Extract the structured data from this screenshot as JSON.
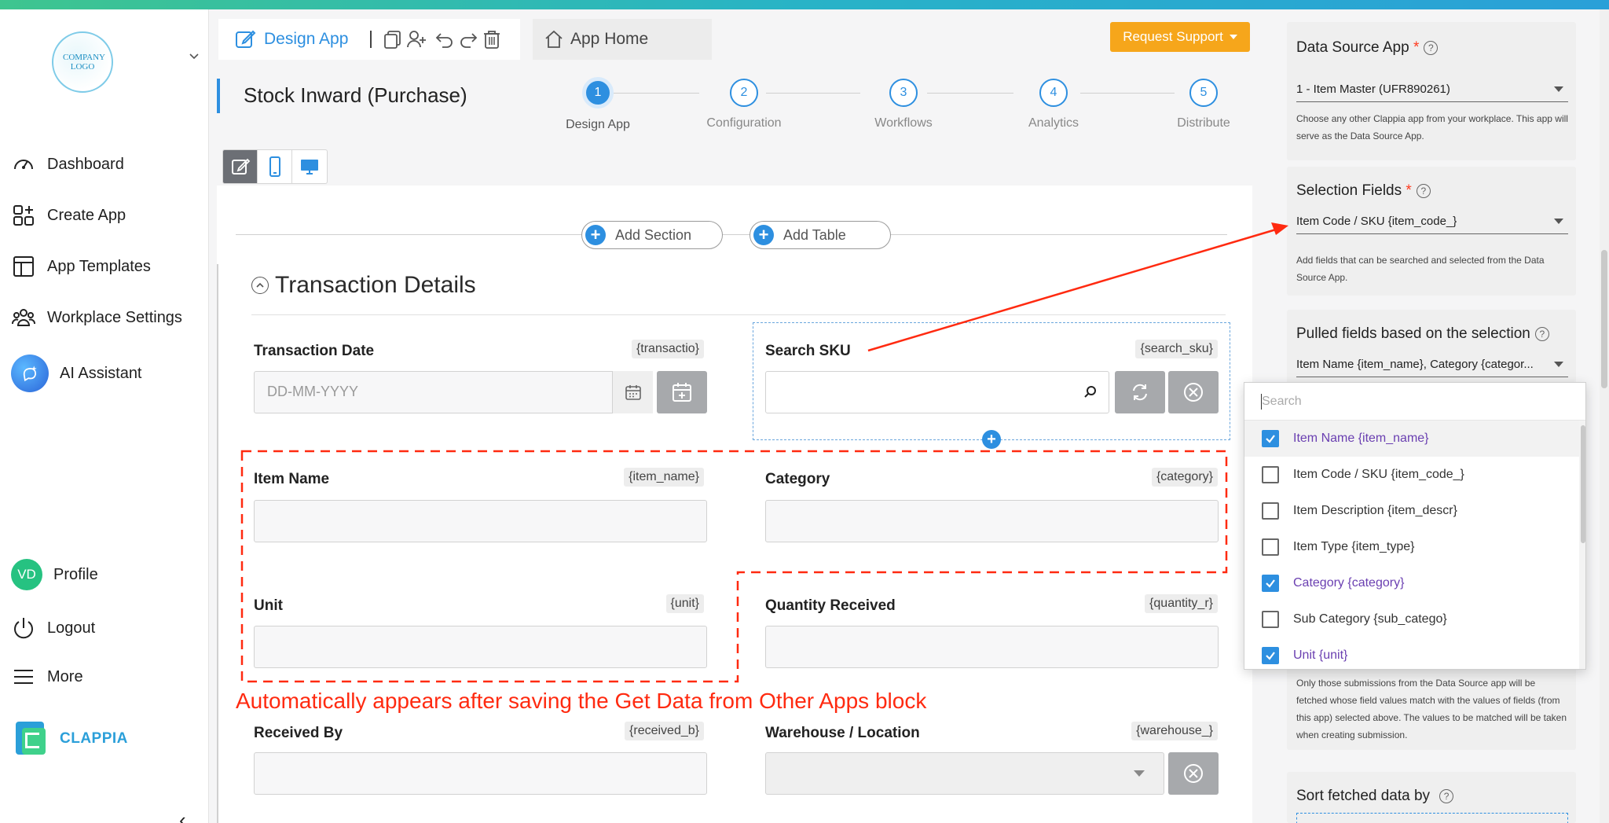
{
  "sidebar": {
    "logo_text": "COMPANY LOGO",
    "nav": [
      {
        "label": "Dashboard",
        "icon": "speedometer-icon"
      },
      {
        "label": "Create App",
        "icon": "grid-plus-icon"
      },
      {
        "label": "App Templates",
        "icon": "layout-icon"
      },
      {
        "label": "Workplace Settings",
        "icon": "users-gear-icon"
      },
      {
        "label": "AI Assistant",
        "icon": "ai-sparkle-icon"
      }
    ],
    "bottom": [
      {
        "label": "Profile",
        "avatar_initials": "VD"
      },
      {
        "label": "Logout",
        "icon": "power-icon"
      },
      {
        "label": "More",
        "icon": "hamburger-icon"
      }
    ],
    "brand": "CLAPPIA",
    "avatar_color": "#26c281"
  },
  "toolbar": {
    "design_app": "Design App",
    "app_home": "App Home",
    "request_support": "Request Support"
  },
  "app": {
    "title": "Stock Inward (Purchase)",
    "steps": [
      {
        "num": "1",
        "label": "Design App",
        "active": true
      },
      {
        "num": "2",
        "label": "Configuration",
        "active": false
      },
      {
        "num": "3",
        "label": "Workflows",
        "active": false
      },
      {
        "num": "4",
        "label": "Analytics",
        "active": false
      },
      {
        "num": "5",
        "label": "Distribute",
        "active": false
      }
    ]
  },
  "canvas": {
    "add_section": "Add Section",
    "add_table": "Add Table",
    "section_title": "Transaction Details",
    "fields": {
      "transaction_date": {
        "label": "Transaction Date",
        "var": "{transactio}",
        "placeholder": "DD-MM-YYYY"
      },
      "search_sku": {
        "label": "Search SKU",
        "var": "{search_sku}"
      },
      "item_name": {
        "label": "Item Name",
        "var": "{item_name}"
      },
      "category": {
        "label": "Category",
        "var": "{category}"
      },
      "unit": {
        "label": "Unit",
        "var": "{unit}"
      },
      "quantity_received": {
        "label": "Quantity Received",
        "var": "{quantity_r}"
      },
      "received_by": {
        "label": "Received By",
        "var": "{received_b}"
      },
      "warehouse": {
        "label": "Warehouse / Location",
        "var": "{warehouse_}"
      }
    },
    "annotation": "Automatically appears after saving the Get Data from Other Apps block",
    "annotation_color": "#ff2a10"
  },
  "right_panel": {
    "data_source": {
      "title": "Data Source App",
      "value": "1 - Item Master (UFR890261)",
      "help": "Choose any other Clappia app from your workplace. This app will serve as the Data Source App."
    },
    "selection_fields": {
      "title": "Selection Fields",
      "value": "Item Code / SKU {item_code_}",
      "help": "Add fields that can be searched and selected from the Data Source App."
    },
    "pulled_fields": {
      "title": "Pulled fields based on the selection",
      "value": "Item Name {item_name}, Category {categor..."
    },
    "match_help": "Only those submissions from the Data Source app will be fetched whose field values match with the values of fields (from this app) selected above. The values to be matched will be taken when creating submission.",
    "sort": {
      "title": "Sort fetched data by"
    }
  },
  "dropdown": {
    "search_placeholder": "Search",
    "options": [
      {
        "label": "Item Name {item_name}",
        "checked": true
      },
      {
        "label": "Item Code / SKU {item_code_}",
        "checked": false
      },
      {
        "label": "Item Description {item_descr}",
        "checked": false
      },
      {
        "label": "Item Type {item_type}",
        "checked": false
      },
      {
        "label": "Category {category}",
        "checked": true
      },
      {
        "label": "Sub Category {sub_catego}",
        "checked": false
      },
      {
        "label": "Unit {unit}",
        "checked": true
      }
    ]
  },
  "colors": {
    "accent": "#2d8fe0",
    "support": "#f6a61b",
    "checked_text": "#6a3fb1"
  }
}
